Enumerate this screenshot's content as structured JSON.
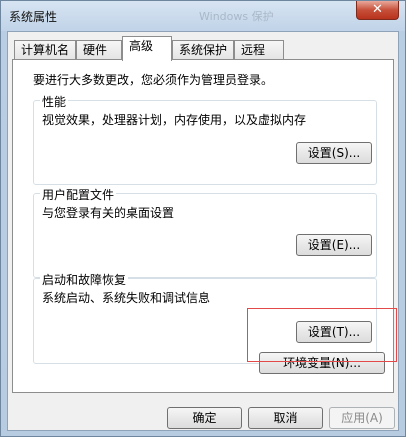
{
  "window": {
    "title": "系统属性",
    "title_ghost": "Windows 保护",
    "close_glyph": "✕"
  },
  "tabs": [
    {
      "label": "计算机名"
    },
    {
      "label": "硬件"
    },
    {
      "label": "高级",
      "active": true
    },
    {
      "label": "系统保护"
    },
    {
      "label": "远程"
    }
  ],
  "advanced": {
    "admin_note": "要进行大多数更改，您必须作为管理员登录。",
    "performance": {
      "label": "性能",
      "desc": "视觉效果，处理器计划，内存使用，以及虚拟内存",
      "button": "设置(S)..."
    },
    "profiles": {
      "label": "用户配置文件",
      "desc": "与您登录有关的桌面设置",
      "button": "设置(E)..."
    },
    "startup": {
      "label": "启动和故障恢复",
      "desc": "系统启动、系统失败和调试信息",
      "button": "设置(T)..."
    },
    "env_button": "环境变量(N)..."
  },
  "footer": {
    "ok": "确定",
    "cancel": "取消",
    "apply": "应用(A)"
  },
  "colors": {
    "highlight": "#e24a4a",
    "close_button": "#c7503a"
  }
}
